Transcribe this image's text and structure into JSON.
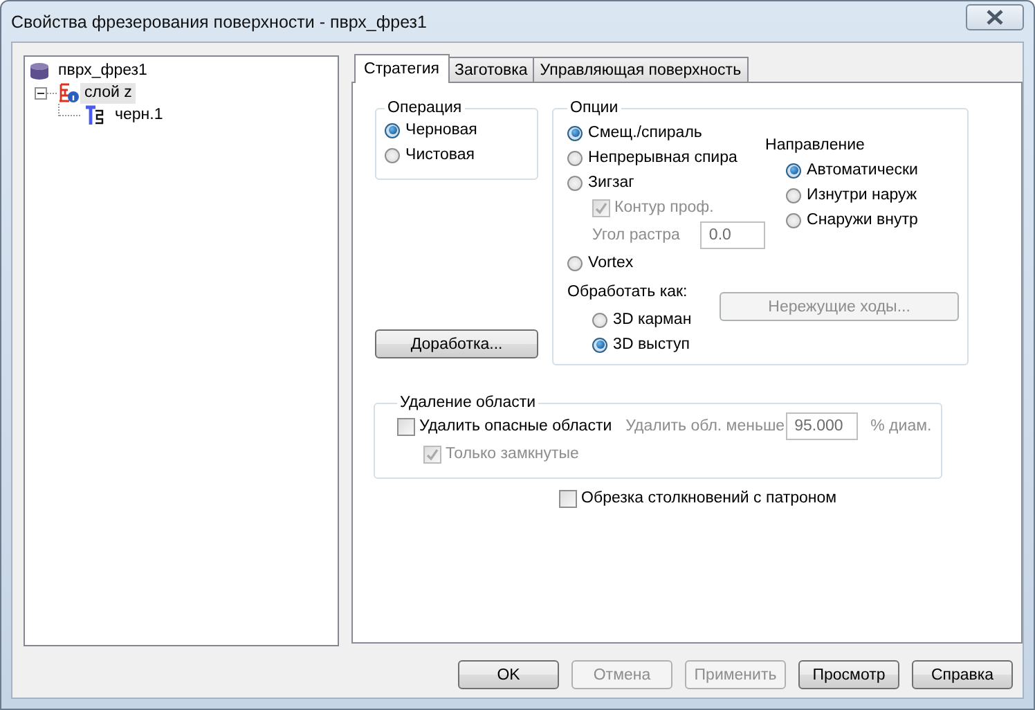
{
  "window": {
    "title": "Свойства фрезерования поверхности - пврх_фрез1"
  },
  "tree": [
    {
      "label": "пврх_фрез1",
      "kind": "database",
      "children": [
        {
          "label": "слой z",
          "kind": "layer",
          "expanded": true,
          "selected": true,
          "children": [
            {
              "label": "черн.1",
              "kind": "tool"
            }
          ]
        }
      ]
    }
  ],
  "tabs": [
    {
      "label": "Стратегия",
      "selected": true
    },
    {
      "label": "Заготовка",
      "selected": false
    },
    {
      "label": "Управляющая поверхность",
      "selected": false
    }
  ],
  "operation": {
    "title": "Операция",
    "options": [
      {
        "label": "Черновая",
        "selected": true
      },
      {
        "label": "Чистовая",
        "selected": false
      }
    ]
  },
  "rework_button": {
    "label": "Доработка..."
  },
  "options": {
    "title": "Опции",
    "methods": [
      {
        "label": "Смещ./спираль",
        "selected": true
      },
      {
        "label": "Непрерывная спира",
        "selected": false
      },
      {
        "label": "Зигзаг",
        "selected": false,
        "settings": {
          "contour": {
            "label": "Контур проф.",
            "checked": true,
            "disabled": true
          },
          "raster_angle": {
            "label": "Угол растра",
            "value": "0.0",
            "disabled": true
          }
        }
      },
      {
        "label": "Vortex",
        "selected": false
      }
    ],
    "direction": {
      "title": "Направление",
      "options": [
        {
          "label": "Автоматически",
          "selected": true
        },
        {
          "label": "Изнутри наруж",
          "selected": false
        },
        {
          "label": "Снаружи внутр",
          "selected": false
        }
      ]
    },
    "process_as": {
      "title": "Обработать как:",
      "options": [
        {
          "label": "3D карман",
          "selected": false
        },
        {
          "label": "3D выступ",
          "selected": true
        }
      ]
    },
    "noncutting_button": {
      "label": "Нережущие ходы...",
      "disabled": true
    }
  },
  "removal": {
    "title": "Удаление области",
    "remove_unsafe": {
      "label": "Удалить опасные области",
      "checked": false,
      "disabled": false
    },
    "smaller_than": {
      "label": "Удалить обл. меньше",
      "value": "95.000",
      "unit": "% диам.",
      "disabled": true
    },
    "only_closed": {
      "label": "Только замкнутые",
      "checked": true,
      "disabled": true
    }
  },
  "holder_clip": {
    "label": "Обрезка столкновений с патроном",
    "checked": false,
    "disabled": false
  },
  "buttons": [
    {
      "label": "OK",
      "disabled": false
    },
    {
      "label": "Отмена",
      "disabled": true
    },
    {
      "label": "Применить",
      "disabled": true
    },
    {
      "label": "Просмотр",
      "disabled": false
    },
    {
      "label": "Справка",
      "disabled": false
    }
  ]
}
